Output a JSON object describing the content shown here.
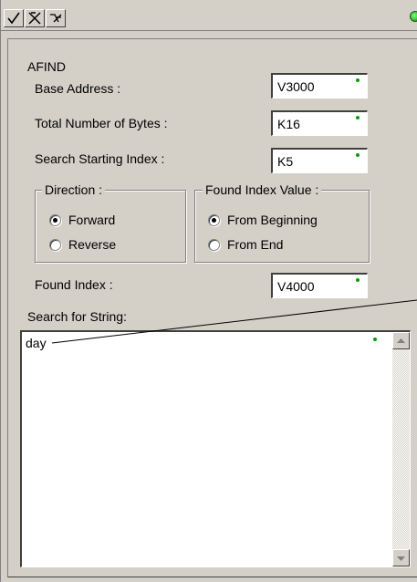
{
  "toolbar": {
    "accept_icon": "check-icon",
    "cancel_icon": "x-icon",
    "help_icon": "help-icon",
    "status_color": "#0b8f0b"
  },
  "form": {
    "title": "AFIND",
    "base_address": {
      "label": "Base Address :",
      "value": "V3000"
    },
    "total_bytes": {
      "label": "Total Number of Bytes :",
      "value": "K16"
    },
    "start_index": {
      "label": "Search Starting Index :",
      "value": "K5"
    },
    "direction": {
      "legend": "Direction :",
      "options": [
        {
          "label": "Forward",
          "selected": true
        },
        {
          "label": "Reverse",
          "selected": false
        }
      ]
    },
    "found_index_value": {
      "legend": "Found Index Value :",
      "options": [
        {
          "label": "From Beginning",
          "selected": true
        },
        {
          "label": "From End",
          "selected": false
        }
      ]
    },
    "found_index": {
      "label": "Found Index :",
      "value": "V4000"
    },
    "search_string": {
      "label": "Search for String:",
      "value": "day"
    }
  }
}
